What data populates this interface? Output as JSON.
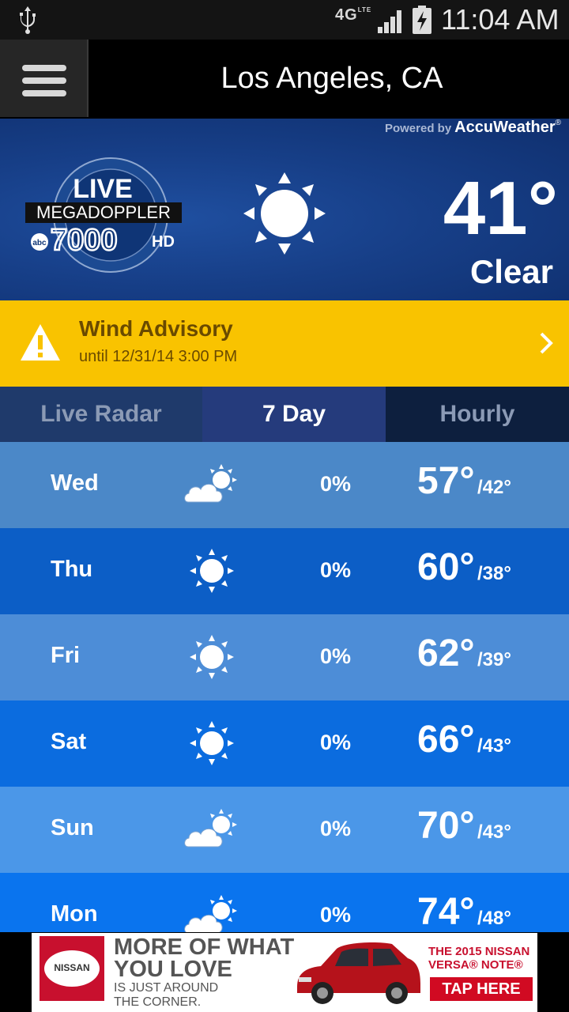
{
  "status_bar": {
    "network": "4G",
    "network_sub": "LTE",
    "time": "11:04 AM",
    "icons": [
      "usb-icon",
      "signal-icon",
      "battery-charging-icon"
    ]
  },
  "header": {
    "menu_icon": "hamburger-menu-icon",
    "city": "Los Angeles, CA"
  },
  "current": {
    "powered_by": "Powered by",
    "provider": "AccuWeather",
    "provider_mark": "®",
    "logo_live": "LIVE",
    "logo_mega": "MEGADOPPLER",
    "logo_abc": "abc",
    "logo_num": "7000",
    "logo_hd": "HD",
    "temp": "41°",
    "condition": "Clear",
    "icon": "sun-icon"
  },
  "alert": {
    "title": "Wind Advisory",
    "subtitle": "until 12/31/14 3:00 PM",
    "icon": "warning-icon",
    "color": "#f9c300"
  },
  "tabs": [
    {
      "label": "Live Radar",
      "active": false
    },
    {
      "label": "7 Day",
      "active": true
    },
    {
      "label": "Hourly",
      "active": false
    }
  ],
  "forecast": [
    {
      "day": "Wed",
      "icon": "partly-cloudy-icon",
      "precip": "0%",
      "hi": "57°",
      "lo": "/42°",
      "color": "#4b88c8"
    },
    {
      "day": "Thu",
      "icon": "sun-icon",
      "precip": "0%",
      "hi": "60°",
      "lo": "/38°",
      "color": "#0c5ec6"
    },
    {
      "day": "Fri",
      "icon": "sun-icon",
      "precip": "0%",
      "hi": "62°",
      "lo": "/39°",
      "color": "#4d8dd7"
    },
    {
      "day": "Sat",
      "icon": "sun-icon",
      "precip": "0%",
      "hi": "66°",
      "lo": "/43°",
      "color": "#0b6cdf"
    },
    {
      "day": "Sun",
      "icon": "partly-cloudy-icon",
      "precip": "0%",
      "hi": "70°",
      "lo": "/43°",
      "color": "#4b97e8"
    },
    {
      "day": "Mon",
      "icon": "partly-cloudy-icon",
      "precip": "0%",
      "hi": "74°",
      "lo": "/48°",
      "color": "#0a74ee"
    }
  ],
  "ad": {
    "brand": "NISSAN",
    "headline_1": "MORE OF WHAT",
    "headline_2": "YOU LOVE",
    "sub_1": "IS JUST AROUND",
    "sub_2": "THE CORNER.",
    "model_1": "THE 2015 NISSAN",
    "model_2": "VERSA® NOTE®",
    "cta": "TAP HERE"
  }
}
